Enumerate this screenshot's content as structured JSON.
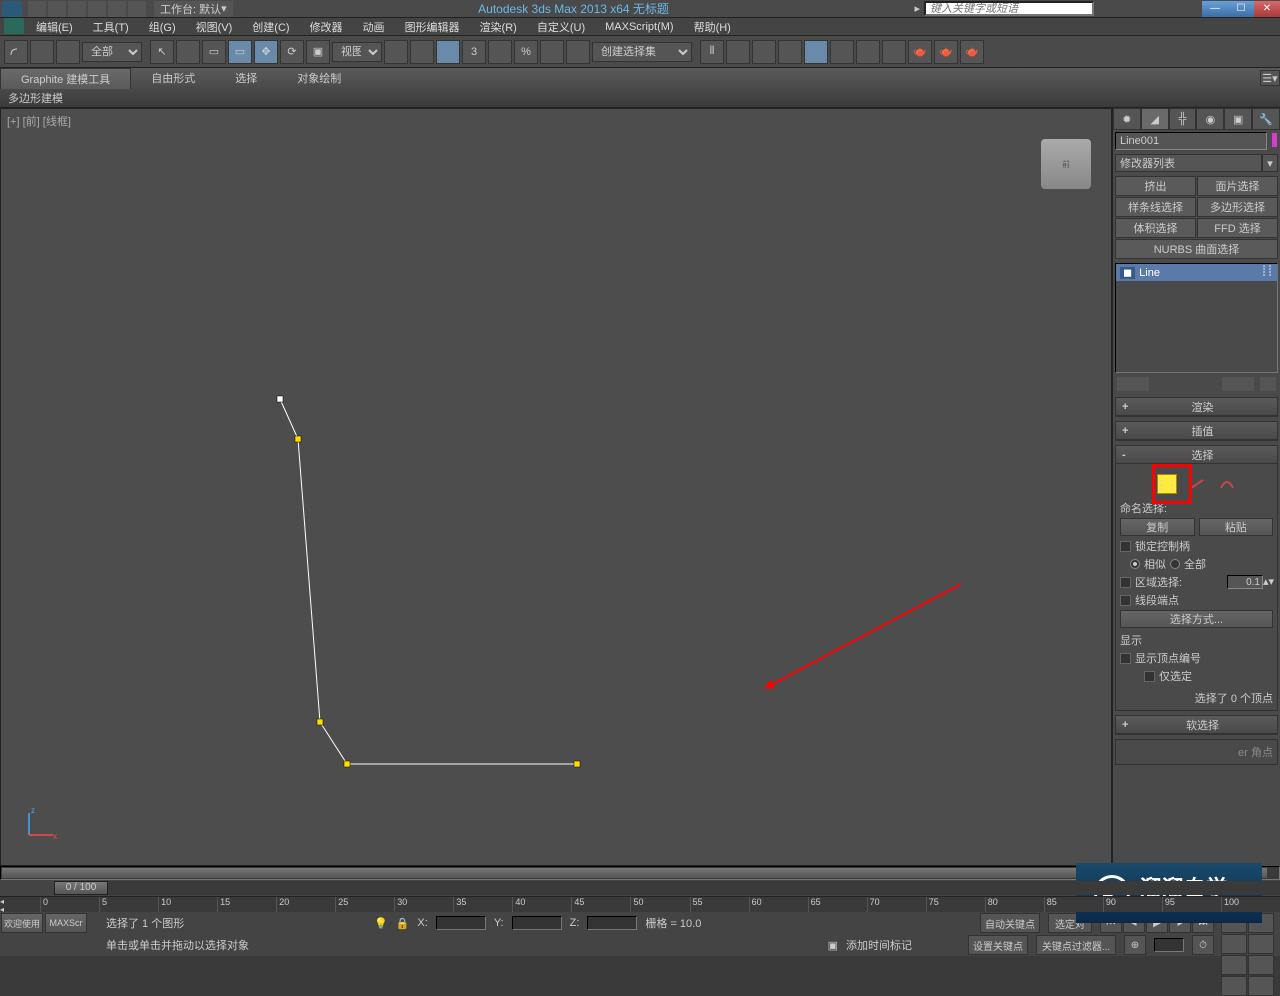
{
  "titlebar": {
    "workspace_label": "工作台: 默认",
    "app_title": "Autodesk 3ds Max  2013 x64    无标题",
    "search_placeholder": "键入关键字或短语"
  },
  "menu": {
    "items": [
      "编辑(E)",
      "工具(T)",
      "组(G)",
      "视图(V)",
      "创建(C)",
      "修改器",
      "动画",
      "图形编辑器",
      "渲染(R)",
      "自定义(U)",
      "MAXScript(M)",
      "帮助(H)"
    ]
  },
  "toolbar": {
    "filter_all": "全部",
    "view_select": "视图",
    "named_set": "创建选择集"
  },
  "ribbon": {
    "tabs": [
      "Graphite 建模工具",
      "自由形式",
      "选择",
      "对象绘制"
    ],
    "sub": "多边形建模"
  },
  "viewport": {
    "label": "[+] [前] [线框]",
    "cube": "前"
  },
  "cmdpanel": {
    "object_name": "Line001",
    "modifier_list": "修改器列表",
    "mod_buttons": [
      "挤出",
      "面片选择",
      "样条线选择",
      "多边形选择",
      "体积选择",
      "FFD 选择",
      "NURBS 曲面选择"
    ],
    "stack_item": "Line",
    "rollouts": {
      "render": "渲染",
      "interp": "插值",
      "selection": "选择",
      "soft": "软选择"
    },
    "sel": {
      "named": "命名选择:",
      "copy": "复制",
      "paste": "粘贴",
      "lock_handles": "锁定控制柄",
      "similar": "相似",
      "all": "全部",
      "area_sel": "区域选择:",
      "area_val": "0.1",
      "seg_end": "线段端点",
      "sel_method": "选择方式...",
      "display": "显示",
      "show_vnum": "显示顶点编号",
      "only_sel": "仅选定",
      "status": "选择了 0 个顶点"
    },
    "geo": {
      "corner": "er 角点"
    }
  },
  "timeline": {
    "frame": "0 / 100",
    "ticks": [
      "0",
      "5",
      "10",
      "15",
      "20",
      "25",
      "30",
      "35",
      "40",
      "45",
      "50",
      "55",
      "60",
      "65",
      "70",
      "75",
      "80",
      "85",
      "90",
      "95",
      "100"
    ]
  },
  "status": {
    "welcome": "欢迎使用",
    "script": "MAXScr",
    "sel_info": "选择了 1 个图形",
    "prompt": "单击或单击并拖动以选择对象",
    "x": "X:",
    "y": "Y:",
    "z": "Z:",
    "grid": "栅格 = 10.0",
    "add_time": "添加时间标记",
    "autokey": "自动关键点",
    "setkey": "设置关键点",
    "sel_opp": "选定对",
    "keyfilter": "关键点过滤器..."
  },
  "watermark": {
    "text": "溜溜自学",
    "url": "ZIXUE.3D66.COM"
  }
}
